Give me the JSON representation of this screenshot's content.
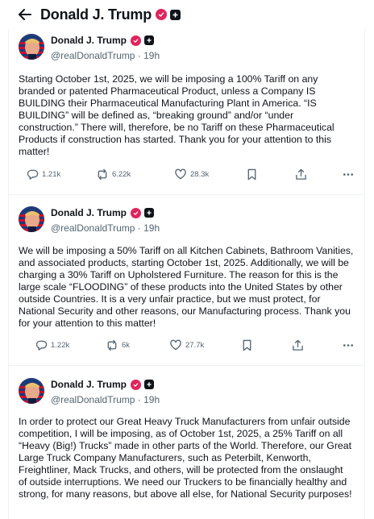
{
  "header": {
    "title": "Donald J. Trump"
  },
  "posts": [
    {
      "name": "Donald J. Trump",
      "handle": "@realDonaldTrump",
      "time": "19h",
      "text": "Starting October 1st, 2025, we will be imposing a 100% Tariff on any branded or patented Pharmaceutical Product, unless a Company IS BUILDING their Pharmaceutical Manufacturing Plant in America. “IS BUILDING” will be defined as, “breaking ground” and/or “under construction.” There will, therefore, be no Tariff on these Pharmaceutical Products if construction has started. Thank you for your attention to this matter!",
      "replies": "1.21k",
      "reposts": "6.22k",
      "likes": "28.3k"
    },
    {
      "name": "Donald J. Trump",
      "handle": "@realDonaldTrump",
      "time": "19h",
      "text": "We will be imposing a 50% Tariff on all Kitchen Cabinets, Bathroom Vanities, and associated products, starting October 1st, 2025. Additionally, we will be charging a 30% Tariff on Upholstered Furniture. The reason for this is the large scale “FLOODING” of these products into the United States by other outside Countries. It is a very unfair practice, but we must protect, for National Security and other reasons, our Manufacturing process. Thank you for your attention to this matter!",
      "replies": "1.22k",
      "reposts": "6k",
      "likes": "27.7k"
    },
    {
      "name": "Donald J. Trump",
      "handle": "@realDonaldTrump",
      "time": "19h",
      "text": "In order to protect our Great Heavy Truck Manufacturers from unfair outside competition, I will be imposing, as of October 1st, 2025, a 25% Tariff on all “Heavy (Big!) Trucks” made in other parts of the World. Therefore, our Great Large Truck Company Manufacturers, such as Peterbilt, Kenworth, Freightliner, Mack Trucks, and others, will be protected from the onslaught of outside interruptions. We need our Truckers to be financially healthy and strong, for many reasons, but above all else, for National Security purposes!"
    }
  ],
  "colors": {
    "verified_badge": "#e0245e",
    "text_primary": "#0f1419",
    "text_secondary": "#536471",
    "border": "#eff3f4"
  },
  "icons": {
    "back": "arrow-left-icon",
    "verified": "verified-badge-icon",
    "org": "org-badge-icon",
    "reply": "reply-icon",
    "repost": "repost-icon",
    "like": "heart-icon",
    "bookmark": "bookmark-icon",
    "share": "share-icon",
    "more": "more-icon"
  }
}
